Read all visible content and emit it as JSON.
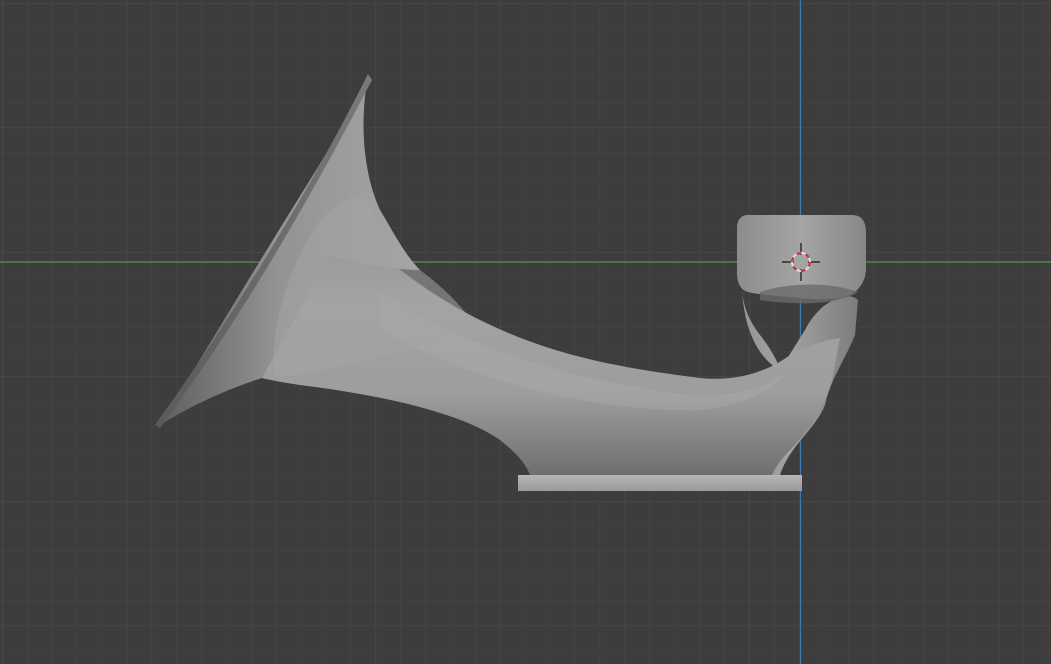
{
  "viewport": {
    "view": "orthographic-side",
    "background_color": "#3d3d3d",
    "grid": {
      "enabled": true,
      "minor_color": "#474747",
      "major_color": "#4c4c4c"
    },
    "axes": {
      "x_axis_color": "#4e9b4a",
      "z_axis_color": "#3f79b0"
    }
  },
  "object": {
    "name": "",
    "shape": "horn-on-stand",
    "color": "#9a9a9a",
    "selected": false
  },
  "cursor": {
    "icon": "3d-cursor-icon",
    "colors": [
      "#d9d9d9",
      "#c8323c"
    ]
  }
}
